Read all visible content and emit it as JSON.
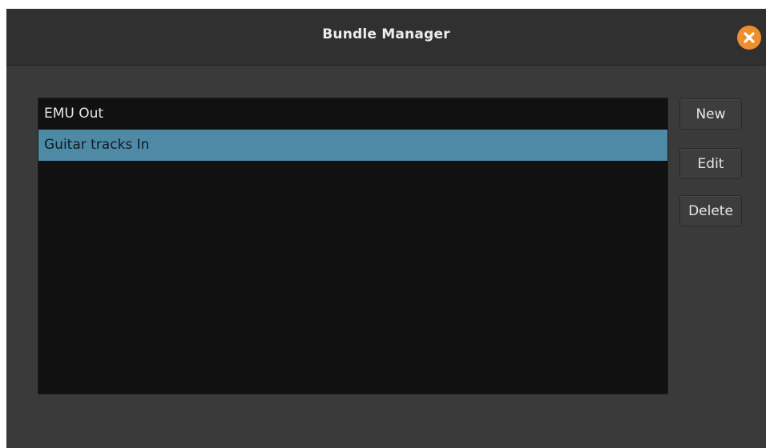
{
  "window": {
    "title": "Bundle Manager"
  },
  "icons": {
    "close": "close-icon"
  },
  "colors": {
    "window_bg": "#3a3a3a",
    "titlebar_bg": "#303030",
    "list_bg": "#111111",
    "selection": "#4e8aa6",
    "close_button": "#ee8e2e"
  },
  "bundles": {
    "items": [
      {
        "label": "EMU Out",
        "selected": false
      },
      {
        "label": "Guitar tracks In",
        "selected": true
      }
    ]
  },
  "actions": {
    "new_label": "New",
    "edit_label": "Edit",
    "delete_label": "Delete"
  }
}
